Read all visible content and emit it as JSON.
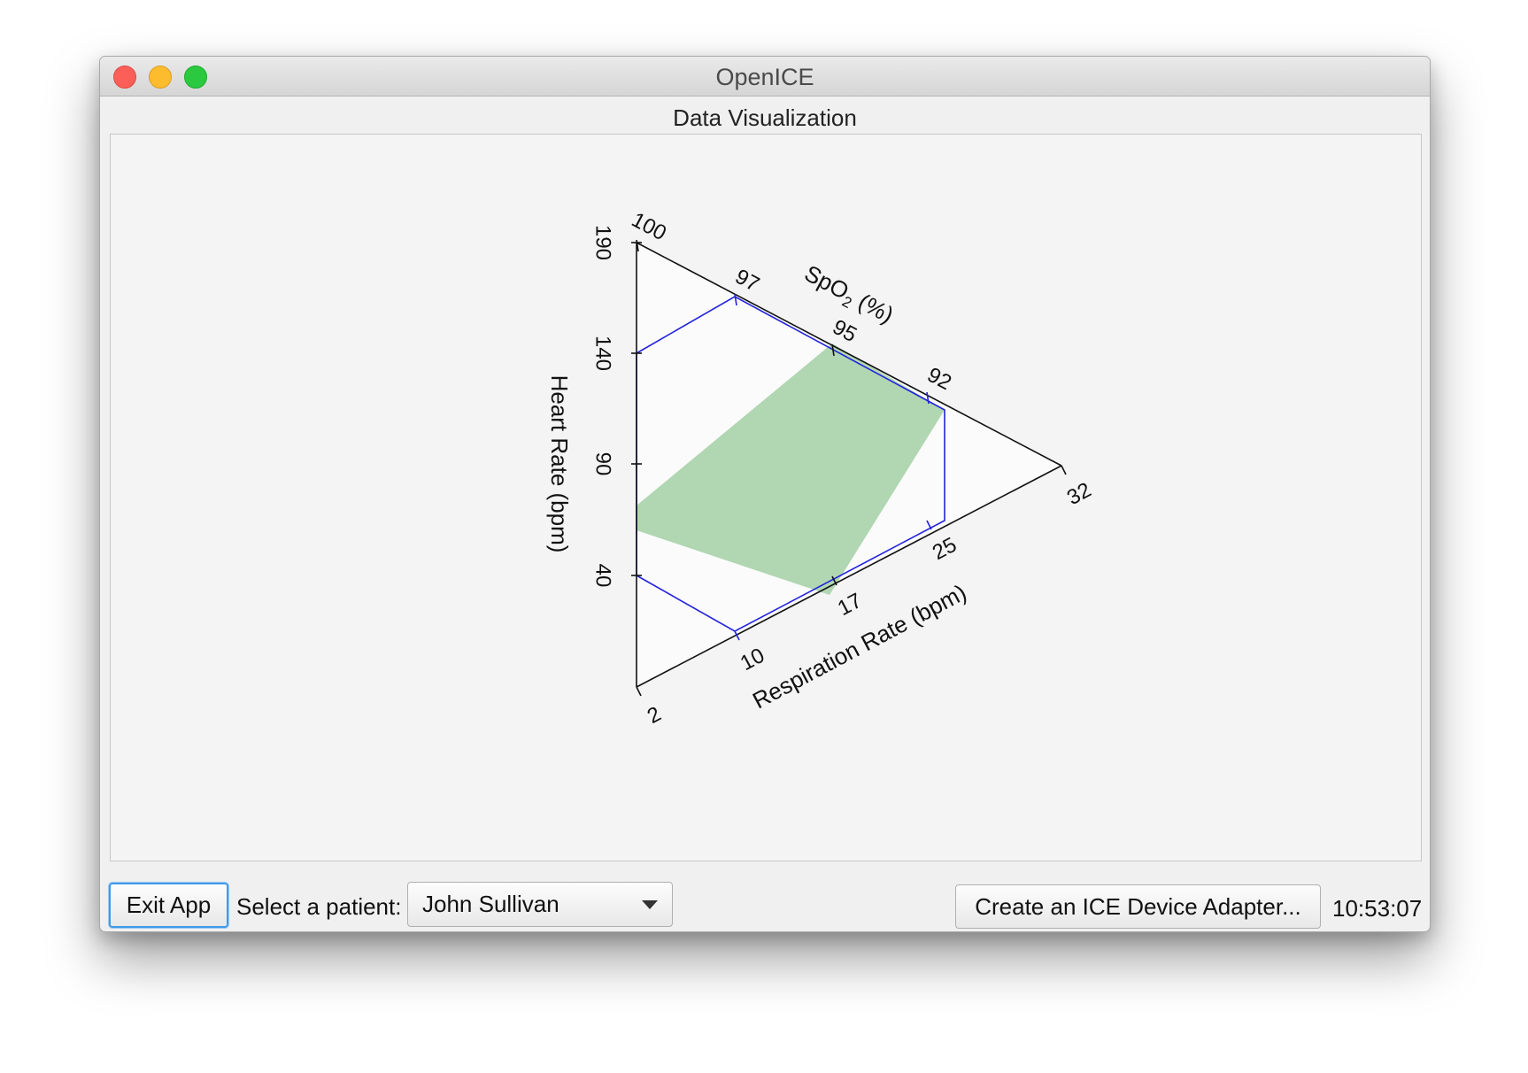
{
  "window": {
    "title": "OpenICE"
  },
  "panel": {
    "title": "Data Visualization"
  },
  "bottom_bar": {
    "exit_label": "Exit App",
    "patient_label": "Select a patient:",
    "patient_selected": "John Sullivan",
    "adapter_label": "Create an ICE Device Adapter...",
    "clock": "10:53:07"
  },
  "colors": {
    "safe_region": "#b0d7b2",
    "range_lines": "#2222dd",
    "axes": "#111111",
    "plot_bg": "#fbfbfb"
  },
  "chart_data": {
    "type": "ternary-radar",
    "axes": [
      {
        "id": "hr",
        "label": "Heart Rate (bpm)",
        "ticks": [
          "190",
          "140",
          "90",
          "40"
        ],
        "ticks_values": [
          190,
          140,
          90,
          40
        ],
        "low_range": 40,
        "high_range": 140
      },
      {
        "id": "spo2",
        "label_main": "SpO",
        "label_sub": "2",
        "label_rest": " (%)",
        "ticks": [
          "100",
          "97",
          "95",
          "92"
        ],
        "ticks_values": [
          100,
          97,
          95,
          92
        ],
        "low_range": 95,
        "high_range": 100
      },
      {
        "id": "rr",
        "label": "Respiration Rate (bpm)",
        "ticks": [
          "2",
          "10",
          "17",
          "25",
          "32"
        ],
        "ticks_values": [
          2,
          10,
          17,
          25,
          32
        ],
        "low_range": 10,
        "high_range": 25
      }
    ]
  }
}
